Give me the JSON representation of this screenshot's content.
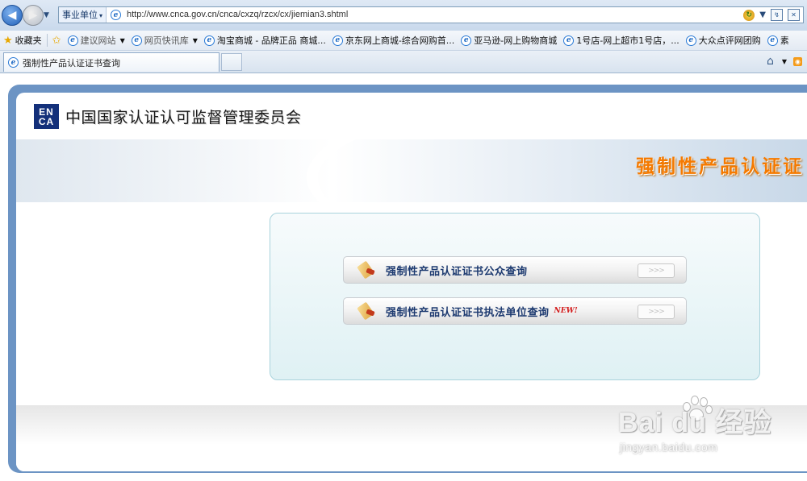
{
  "browser": {
    "zone_label": "事业单位",
    "url": "http://www.cnca.gov.cn/cnca/cxzq/rzcx/cx/jiemian3.shtml",
    "favorites": {
      "favorites_label": "收藏夹",
      "items": [
        {
          "label": "建议网站",
          "dropdown": true
        },
        {
          "label": "网页快讯库",
          "dropdown": true
        },
        {
          "label": "淘宝商城 - 品牌正品 商城..."
        },
        {
          "label": "京东网上商城-综合网购首..."
        },
        {
          "label": "亚马逊-网上购物商城"
        },
        {
          "label": "1号店-网上超市1号店，..."
        },
        {
          "label": "大众点评网团购"
        },
        {
          "label": "素"
        }
      ]
    },
    "active_tab_title": "强制性产品认证证书查询"
  },
  "page": {
    "logo_text_top": "EN",
    "logo_text_bottom": "CA",
    "org_name": "中国国家认证认可监督管理委员会",
    "banner_title": "强制性产品认证证",
    "query_buttons": [
      {
        "label": "强制性产品认证证书公众查询",
        "badge": ""
      },
      {
        "label": "强制性产品认证证书执法单位查询",
        "badge": "NEW!"
      }
    ],
    "arrow_glyph": ">>>"
  },
  "watermark": {
    "main": "Bai du 经验",
    "sub": "jingyan.baidu.com"
  },
  "colors": {
    "frame_blue": "#6c94c4",
    "banner_orange": "#f57a00",
    "logo_navy": "#13307a",
    "button_text": "#1d3a70",
    "new_red": "#d31b1b"
  }
}
